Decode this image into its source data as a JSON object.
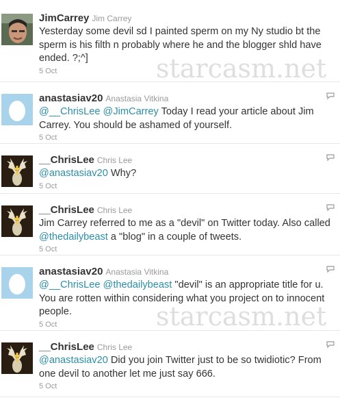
{
  "watermark": "starcasm.net",
  "colors": {
    "mention": "#2b8ea8",
    "muted": "#999999",
    "text": "#333333"
  },
  "tweets": [
    {
      "handle": "JimCarrey",
      "fullname": "Jim Carrey",
      "avatar": "photo-avatar",
      "segments": [
        {
          "text": "Yesterday some devil sd I painted sperm on my Ny studio bt the sperm is his filth n probably where he and the blogger shld have ended. ?;^]"
        }
      ],
      "time": "5 Oct",
      "reply_icon": false
    },
    {
      "handle": "anastasiav20",
      "fullname": "Anastasia Vitkina",
      "avatar": "egg-avatar",
      "segments": [
        {
          "text": "@__ChrisLee",
          "mention": true
        },
        {
          "text": " "
        },
        {
          "text": "@JimCarrey",
          "mention": true
        },
        {
          "text": " Today I read your article about Jim Carrey. You should be ashamed of yourself."
        }
      ],
      "time": "5 Oct",
      "reply_icon": true
    },
    {
      "handle": "__ChrisLee",
      "fullname": "Chris Lee",
      "avatar": "stag-avatar",
      "segments": [
        {
          "text": "@anastasiav20",
          "mention": true
        },
        {
          "text": " Why?"
        }
      ],
      "time": "5 Oct",
      "reply_icon": true
    },
    {
      "handle": "__ChrisLee",
      "fullname": "Chris Lee",
      "avatar": "stag-avatar",
      "segments": [
        {
          "text": "Jim Carrey referred to me as a \"devil\" on Twitter today. Also called "
        },
        {
          "text": "@thedailybeast",
          "mention": true
        },
        {
          "text": " a \"blog\" in a couple of tweets."
        }
      ],
      "time": "5 Oct",
      "reply_icon": true
    },
    {
      "handle": "anastasiav20",
      "fullname": "Anastasia Vitkina",
      "avatar": "egg-avatar",
      "segments": [
        {
          "text": "@__ChrisLee",
          "mention": true
        },
        {
          "text": " "
        },
        {
          "text": "@thedailybeast",
          "mention": true
        },
        {
          "text": " \"devil\" is an appropriate title for u. You are rotten within considering what you project on to innocent people."
        }
      ],
      "time": "5 Oct",
      "reply_icon": true
    },
    {
      "handle": "__ChrisLee",
      "fullname": "Chris Lee",
      "avatar": "stag-avatar",
      "segments": [
        {
          "text": "@anastasiav20",
          "mention": true
        },
        {
          "text": " Did you join Twitter just to be so twidiotic? From one devil to another let me just say 666."
        }
      ],
      "time": "5 Oct",
      "reply_icon": true
    }
  ]
}
